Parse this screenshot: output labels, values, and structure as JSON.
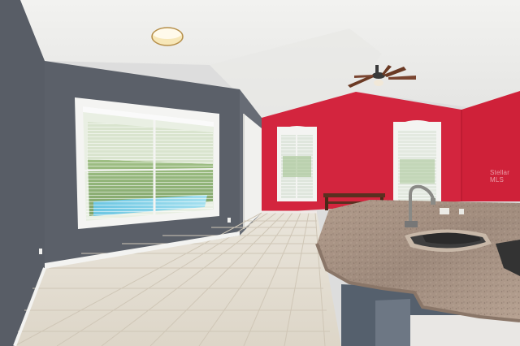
{
  "photo": {
    "subject": "interior-kitchen-living-area",
    "watermark_text": "Stellar MLS",
    "colors": {
      "ceiling": "#efefed",
      "gray_wall": "#5a6068",
      "red_wall": "#d5263f",
      "tile_floor": "#e8e2d6",
      "granite": "#a89282",
      "baseboard": "#f4f4f2",
      "pool_water": "#7fd0e6"
    }
  }
}
